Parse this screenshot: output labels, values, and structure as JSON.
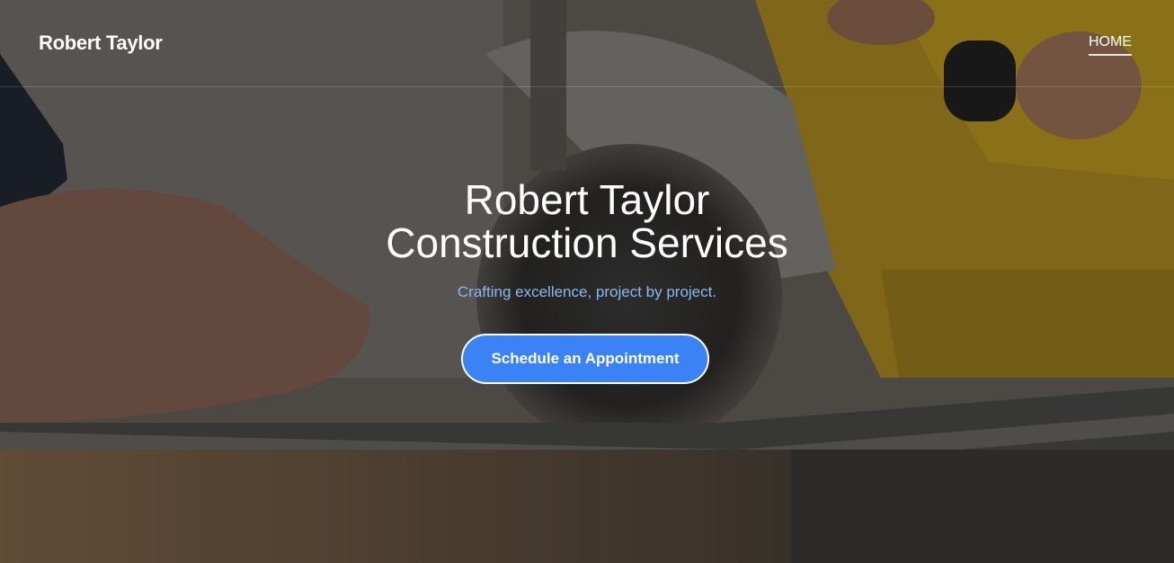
{
  "header": {
    "brand": "Robert Taylor",
    "nav": {
      "home_label": "HOME"
    }
  },
  "hero": {
    "title_line1": "Robert Taylor",
    "title_line2": "Construction Services",
    "tagline": "Crafting excellence, project by project.",
    "cta_label": "Schedule an Appointment"
  },
  "colors": {
    "accent": "#3b82f6",
    "tagline": "#8ab8f0",
    "saw_yellow": "#c9a21a"
  }
}
